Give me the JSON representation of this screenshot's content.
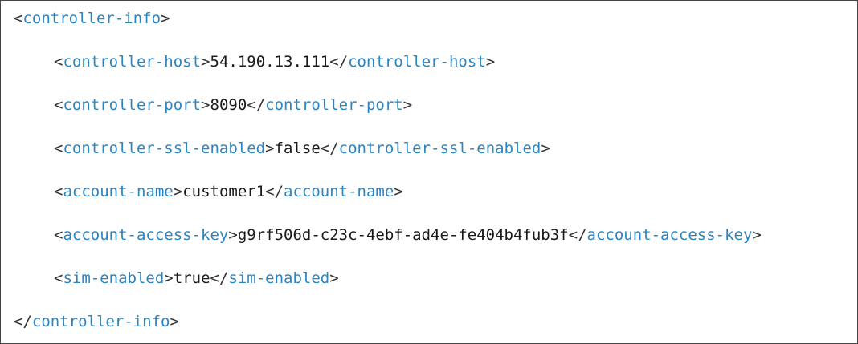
{
  "snippet": {
    "root_tag": "controller-info",
    "children": [
      {
        "tag": "controller-host",
        "value": "54.190.13.111"
      },
      {
        "tag": "controller-port",
        "value": "8090"
      },
      {
        "tag": "controller-ssl-enabled",
        "value": "false"
      },
      {
        "tag": "account-name",
        "value": "customer1"
      },
      {
        "tag": "account-access-key",
        "value": "g9rf506d-c23c-4ebf-ad4e-fe404b4fub3f"
      },
      {
        "tag": "sim-enabled",
        "value": "true"
      }
    ]
  },
  "colors": {
    "tag": "#2a86c2",
    "text": "#1a1a1a",
    "border": "#444444"
  }
}
